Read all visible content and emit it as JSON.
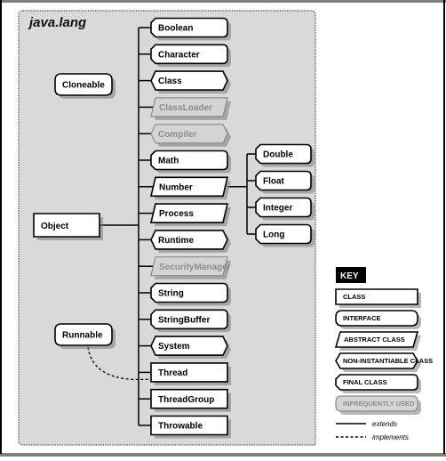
{
  "package": {
    "title": "java.lang"
  },
  "colors": {
    "package_fill": "#d9d9d9",
    "box_fill": "#ffffff",
    "faded_fill": "#d4d4d4",
    "stroke": "#000000",
    "faded_stroke": "#8c8c8c",
    "shadow": "#7a7a7a",
    "frame_gray": "#808080"
  },
  "root": {
    "name": "Object",
    "kind": "class"
  },
  "interfaces": [
    {
      "name": "Cloneable",
      "kind": "interface"
    },
    {
      "name": "Runnable",
      "kind": "interface"
    }
  ],
  "object_subclasses": [
    {
      "name": "Boolean",
      "kind": "final"
    },
    {
      "name": "Character",
      "kind": "final"
    },
    {
      "name": "Class",
      "kind": "noninstantiable"
    },
    {
      "name": "ClassLoader",
      "kind": "abstract",
      "infrequent": true
    },
    {
      "name": "Compiler",
      "kind": "noninstantiable",
      "infrequent": true
    },
    {
      "name": "Math",
      "kind": "final"
    },
    {
      "name": "Number",
      "kind": "abstract"
    },
    {
      "name": "Process",
      "kind": "abstract"
    },
    {
      "name": "Runtime",
      "kind": "noninstantiable"
    },
    {
      "name": "SecurityManager",
      "kind": "abstract",
      "infrequent": true
    },
    {
      "name": "String",
      "kind": "final"
    },
    {
      "name": "StringBuffer",
      "kind": "final"
    },
    {
      "name": "System",
      "kind": "noninstantiable"
    },
    {
      "name": "Thread",
      "kind": "class",
      "implements": "Runnable"
    },
    {
      "name": "ThreadGroup",
      "kind": "class"
    },
    {
      "name": "Throwable",
      "kind": "class"
    }
  ],
  "number_subclasses": [
    {
      "name": "Double",
      "kind": "final"
    },
    {
      "name": "Float",
      "kind": "final"
    },
    {
      "name": "Integer",
      "kind": "final"
    },
    {
      "name": "Long",
      "kind": "final"
    }
  ],
  "key": {
    "title": "KEY",
    "items": [
      {
        "label": "CLASS",
        "kind": "class"
      },
      {
        "label": "INTERFACE",
        "kind": "interface"
      },
      {
        "label": "ABSTRACT CLASS",
        "kind": "abstract"
      },
      {
        "label": "NON-INSTANTIABLE CLASS",
        "kind": "noninstantiable"
      },
      {
        "label": "FINAL CLASS",
        "kind": "final"
      },
      {
        "label": "INFREQUENTLY USED",
        "kind": "infrequent"
      }
    ],
    "lines": [
      {
        "label": "extends",
        "style": "solid"
      },
      {
        "label": "implements",
        "style": "dashed"
      }
    ]
  }
}
